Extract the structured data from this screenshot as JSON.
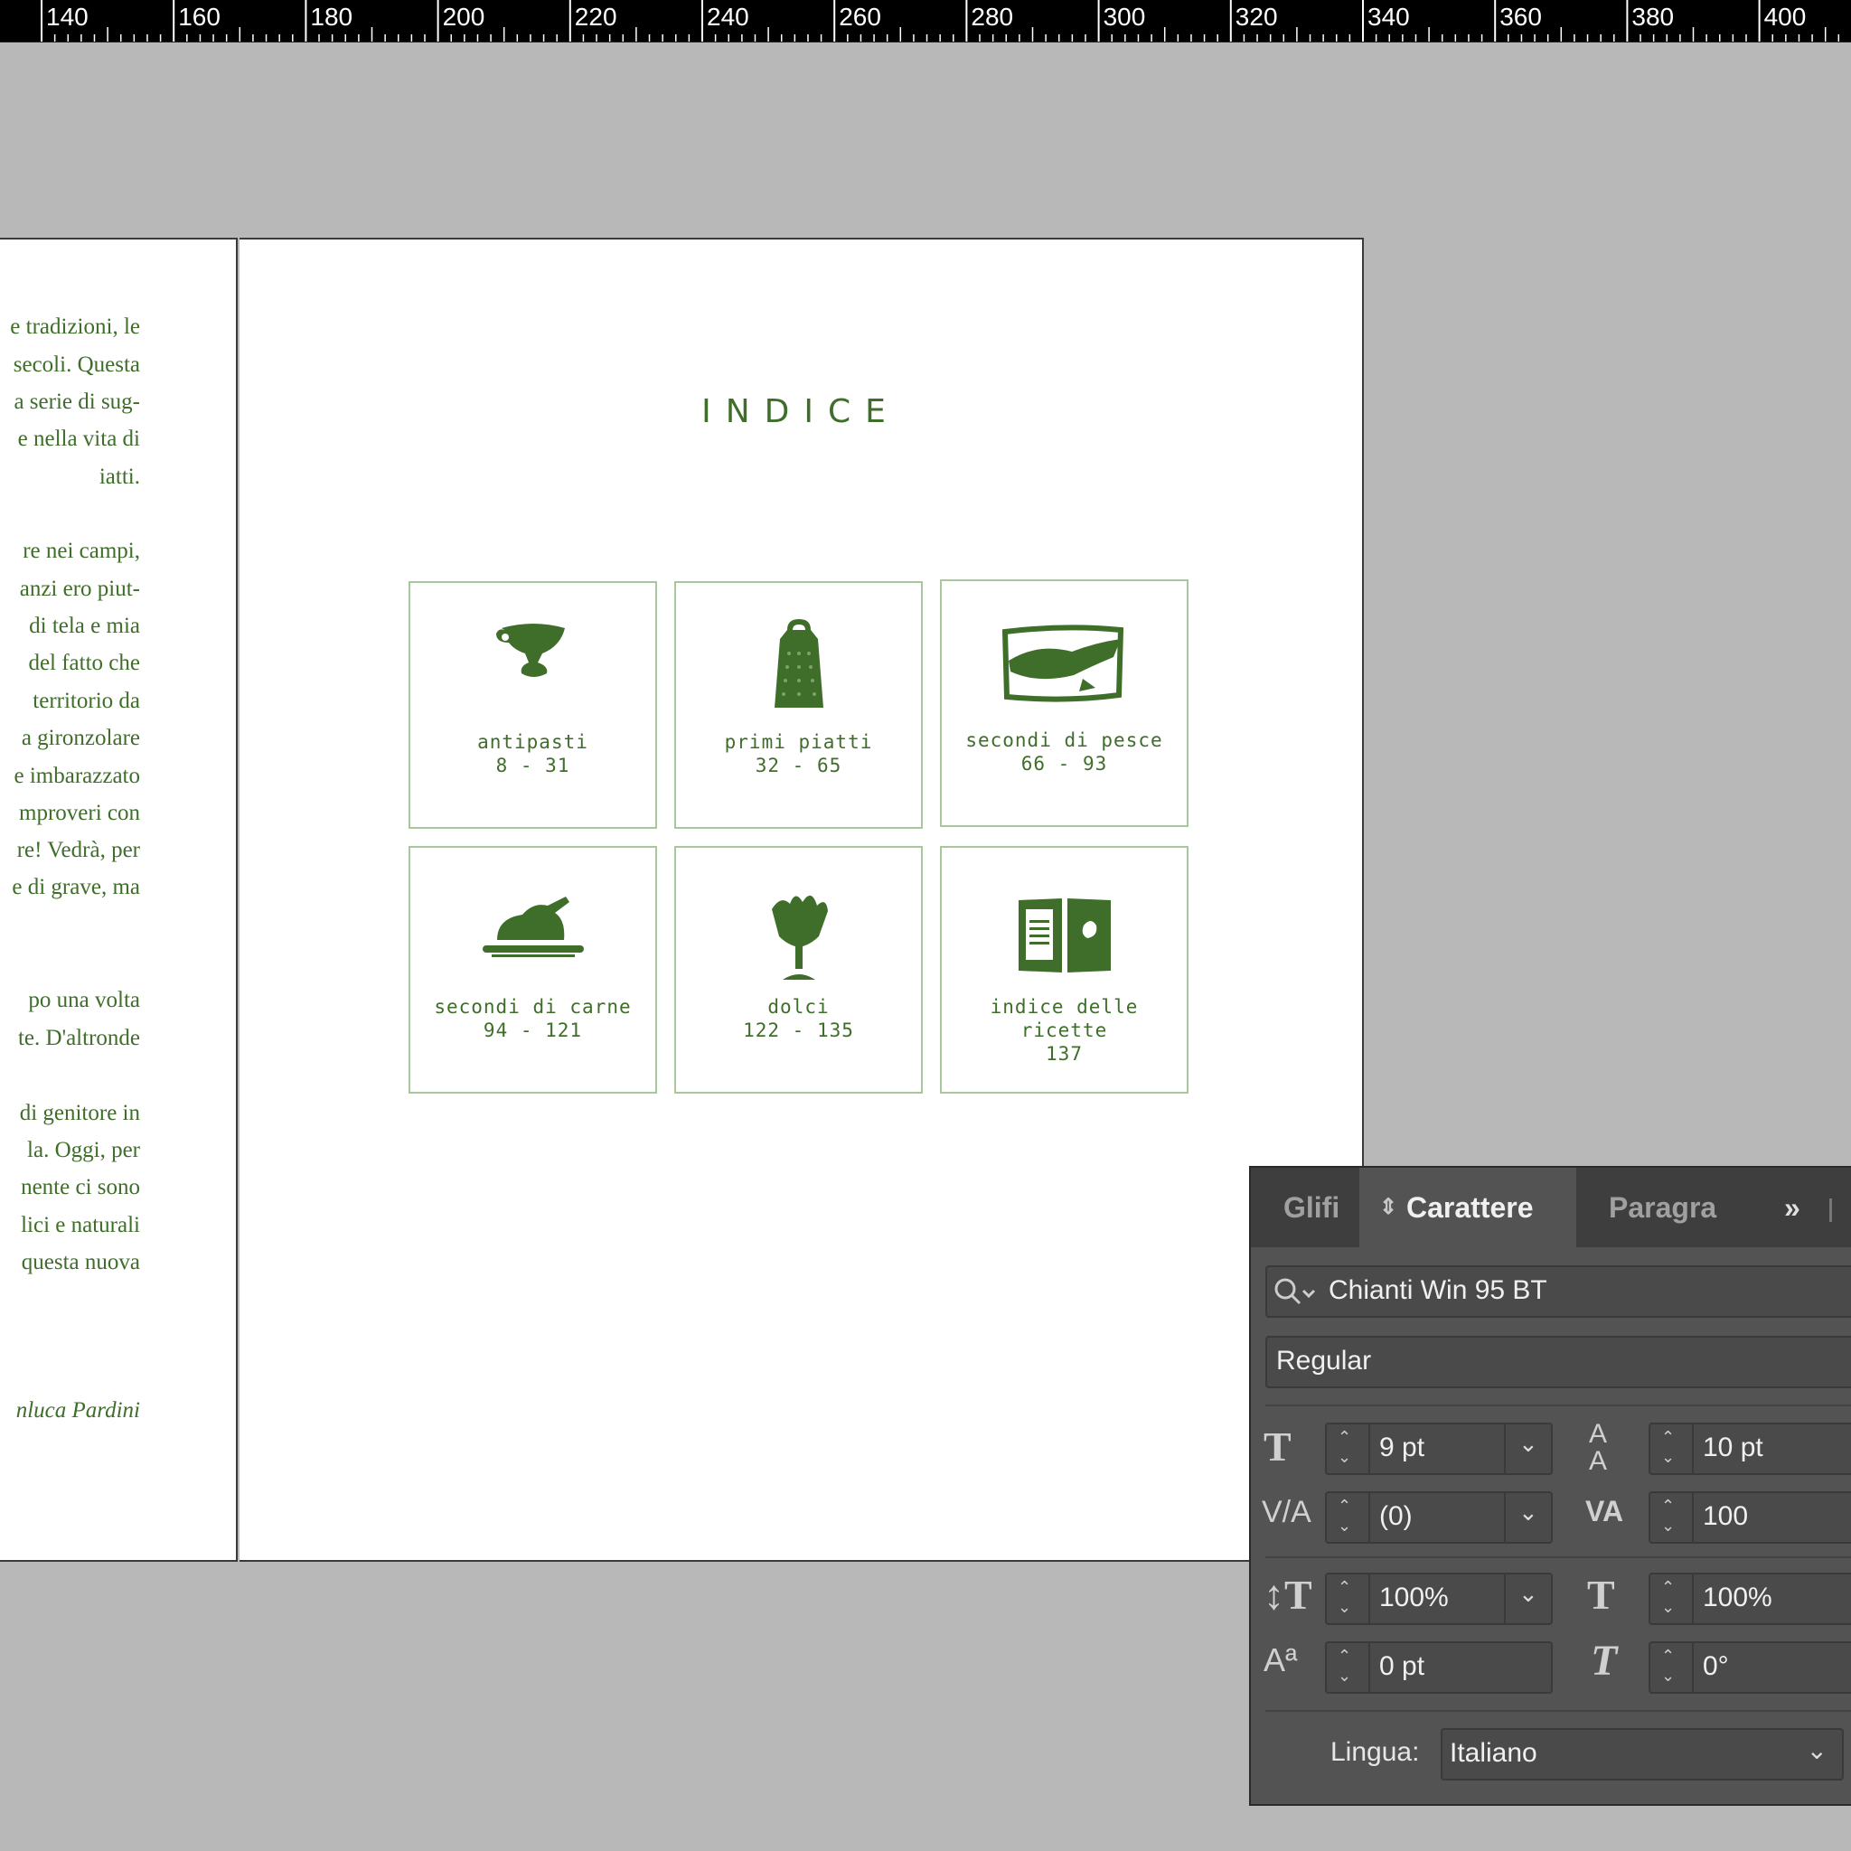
{
  "ruler": {
    "labels": [
      "140",
      "160",
      "180",
      "200",
      "220",
      "240",
      "260",
      "280",
      "300",
      "320",
      "340",
      "360",
      "380",
      "400"
    ]
  },
  "left_page": {
    "lines": [
      "e tradizioni, le",
      "secoli. Questa",
      "a serie di sug-",
      "e nella vita di",
      "iatti.",
      "re nei campi,",
      "anzi ero piut-",
      "di tela e mia",
      "del fatto che",
      "territorio da",
      "a gironzolare",
      "e imbarazzato",
      "mproveri con",
      "re! Vedrà, per",
      "e di grave, ma",
      "po una volta",
      "te. D'altronde",
      "di genitore in",
      "la. Oggi, per",
      "nente ci sono",
      "lici e naturali",
      "questa nuova",
      "nluca Pardini"
    ]
  },
  "index_page": {
    "title": "INDICE",
    "cards": [
      {
        "name": "antipasti",
        "pages": "8 - 31",
        "icon": "gravy-boat-icon"
      },
      {
        "name": "primi piatti",
        "pages": "32 - 65",
        "icon": "grater-icon"
      },
      {
        "name": "secondi di pesce",
        "pages": "66 - 93",
        "icon": "fish-platter-icon"
      },
      {
        "name": "secondi di carne",
        "pages": "94 - 121",
        "icon": "roast-chicken-icon"
      },
      {
        "name": "dolci",
        "pages": "122 - 135",
        "icon": "sundae-icon"
      },
      {
        "name": "indice delle ricette",
        "pages": "137",
        "icon": "open-book-icon"
      }
    ]
  },
  "panel": {
    "tabs": [
      "Glifi",
      "Carattere",
      "Paragra"
    ],
    "active_tab": "Carattere",
    "font_family": "Chianti Win 95 BT",
    "font_style": "Regular",
    "size": "9 pt",
    "leading": "10 pt",
    "kerning": "(0)",
    "tracking": "100",
    "vertical_scale": "100%",
    "horizontal_scale": "100%",
    "baseline_shift": "0 pt",
    "skew": "0°",
    "language_label": "Lingua:",
    "language": "Italiano"
  },
  "colors": {
    "text_green": "#3f6e2a",
    "card_border": "#a8c79a",
    "panel_bg": "#535353"
  }
}
